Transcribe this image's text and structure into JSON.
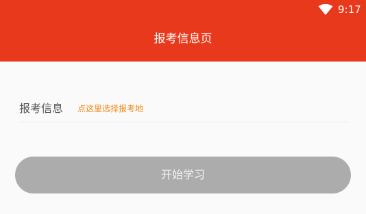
{
  "status_bar": {
    "time": "9:17",
    "wifi_icon": "wifi-icon"
  },
  "header": {
    "title": "报考信息页",
    "background_color": "#e8391d"
  },
  "form": {
    "label": "报考信息",
    "value": "点这里选择报考地",
    "value_color": "#ef8a16"
  },
  "actions": {
    "start_label": "开始学习",
    "start_button_color": "#acacac"
  }
}
